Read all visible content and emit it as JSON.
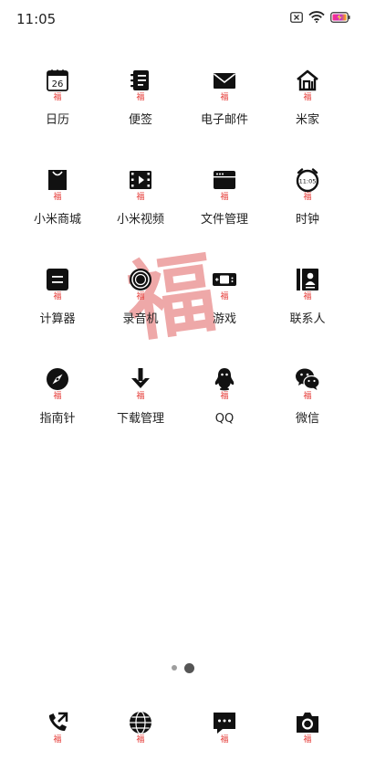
{
  "status_bar": {
    "time": "11:05",
    "icons": [
      "sim-x-icon",
      "wifi-icon",
      "battery-charging-icon"
    ]
  },
  "fu_char": "福",
  "big_fu_char": "福",
  "apps": [
    {
      "label": "日历",
      "icon": "calendar-icon",
      "calendar_day": "26"
    },
    {
      "label": "便签",
      "icon": "notes-icon"
    },
    {
      "label": "电子邮件",
      "icon": "mail-icon"
    },
    {
      "label": "米家",
      "icon": "mijia-home-icon"
    },
    {
      "label": "小米商城",
      "icon": "shopping-bag-icon"
    },
    {
      "label": "小米视频",
      "icon": "video-icon"
    },
    {
      "label": "文件管理",
      "icon": "file-manager-icon"
    },
    {
      "label": "时钟",
      "icon": "clock-icon",
      "clock_time": "11:05"
    },
    {
      "label": "计算器",
      "icon": "calculator-icon"
    },
    {
      "label": "录音机",
      "icon": "recorder-icon"
    },
    {
      "label": "游戏",
      "icon": "game-icon"
    },
    {
      "label": "联系人",
      "icon": "contacts-icon"
    },
    {
      "label": "指南针",
      "icon": "compass-icon"
    },
    {
      "label": "下载管理",
      "icon": "download-icon"
    },
    {
      "label": "QQ",
      "icon": "qq-icon"
    },
    {
      "label": "微信",
      "icon": "wechat-icon"
    }
  ],
  "pager": {
    "pages": 2,
    "current": 2
  },
  "dock": [
    {
      "icon": "phone-icon"
    },
    {
      "icon": "browser-icon"
    },
    {
      "icon": "messages-icon"
    },
    {
      "icon": "camera-icon"
    }
  ],
  "colors": {
    "fu_text": "#e53935",
    "big_fu": "#ec9a9a",
    "icon": "#111111"
  }
}
